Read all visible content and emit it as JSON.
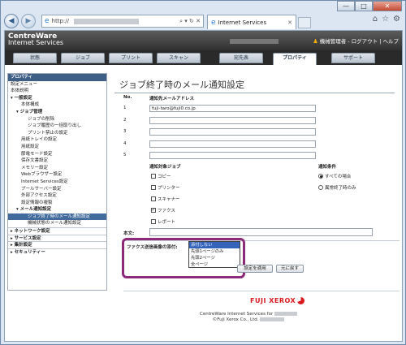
{
  "browser": {
    "url": "http://",
    "tab_title": "Internet Services",
    "window_controls": {
      "min": "—",
      "max": "□",
      "close": "✕"
    },
    "toolbar_icons": {
      "home": "⌂",
      "favorites": "☆",
      "tools": "⚙"
    }
  },
  "header": {
    "logo_top": "CentreWare",
    "logo_bottom": "Internet Services",
    "user_info": "機械管理者 - ログアウト | ヘルプ"
  },
  "nav_tabs": [
    {
      "label": "状態"
    },
    {
      "label": "ジョブ"
    },
    {
      "label": "プリント"
    },
    {
      "label": "スキャン"
    },
    {
      "label": "宛先表"
    },
    {
      "label": "プロパティ"
    },
    {
      "label": "サポート"
    }
  ],
  "sidebar": {
    "title": "プロパティ",
    "items": [
      {
        "label": "設定メニュー"
      },
      {
        "label": "本体説明"
      },
      {
        "label": "▾ 一般設定"
      },
      {
        "label": "本体構成"
      },
      {
        "label": "▾ ジョブ管理"
      },
      {
        "label": "ジョブの削除"
      },
      {
        "label": "ジョブ履歴の一括取り出し"
      },
      {
        "label": "プリント禁止の設定"
      },
      {
        "label": "用紙トレイの設定"
      },
      {
        "label": "用紙設定"
      },
      {
        "label": "節電モード設定"
      },
      {
        "label": "保存文書設定"
      },
      {
        "label": "メモリー設定"
      },
      {
        "label": "Webブラウザー設定"
      },
      {
        "label": "Internet Services設定"
      },
      {
        "label": "プールサーバー設定"
      },
      {
        "label": "外部アクセス設定"
      },
      {
        "label": "設定情報の複製"
      },
      {
        "label": "▾ メール通知設定"
      },
      {
        "label": "ジョブ終了時のメール通知設定"
      },
      {
        "label": "機械状態のメール通知設定"
      },
      {
        "label": "▸ ネットワーク設定"
      },
      {
        "label": "▸ サービス設定"
      },
      {
        "label": "▸ 集計設定"
      },
      {
        "label": "▸ セキュリティー"
      }
    ]
  },
  "main": {
    "title": "ジョブ終了時のメール通知設定",
    "no_header": "No.",
    "address_header": "通知先メールアドレス",
    "rows": [
      {
        "no": "1",
        "value": "fuji-taro@fuji0.co.jp"
      },
      {
        "no": "2",
        "value": ""
      },
      {
        "no": "3",
        "value": ""
      },
      {
        "no": "4",
        "value": ""
      },
      {
        "no": "5",
        "value": ""
      }
    ],
    "target_jobs_label": "通知対象ジョブ",
    "jobs": [
      {
        "label": "コピー",
        "checked": false
      },
      {
        "label": "プリンター",
        "checked": false
      },
      {
        "label": "スキャナー",
        "checked": false
      },
      {
        "label": "ファクス",
        "checked": true
      },
      {
        "label": "レポート",
        "checked": false
      }
    ],
    "condition_label": "通知条件",
    "conditions": [
      {
        "label": "すべての場合",
        "selected": true
      },
      {
        "label": "異常終了時のみ",
        "selected": false
      }
    ],
    "body_label": "本文:",
    "body_value": "",
    "fax_attach_label": "ファクス送信画像の添付:",
    "fax_attach_options": [
      "添付しない",
      "先頭1ページのみ",
      "先頭2ページ",
      "全ページ"
    ],
    "fax_attach_selected": "添付しない",
    "apply_button": "設定を適用",
    "reset_button": "元に戻す"
  },
  "footer": {
    "brand": "FUJI XEROX",
    "line1": "CentreWare Internet Services for",
    "line2": "©Fuji Xerox Co., Ltd."
  }
}
